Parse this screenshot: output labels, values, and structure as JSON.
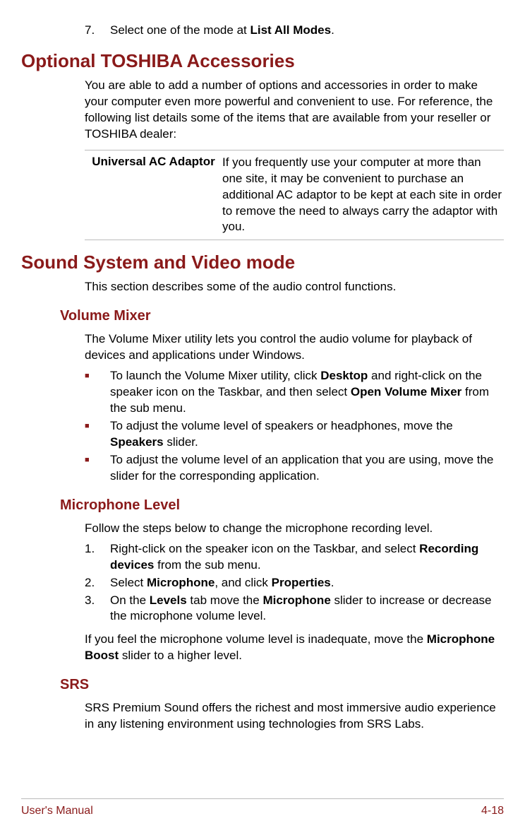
{
  "step7": {
    "num": "7.",
    "pre": "Select one of the mode at ",
    "bold": "List All Modes",
    "post": "."
  },
  "h1_accessories": "Optional TOSHIBA Accessories",
  "accessories_intro": "You are able to add a number of options and accessories in order to make your computer even more powerful and convenient to use. For reference, the following list details some of the items that are available from your reseller or TOSHIBA dealer:",
  "accessory": {
    "label": "Universal AC Adaptor",
    "desc": "If you frequently use your computer at more than one site, it may be convenient to purchase an additional AC adaptor to be kept at each site in order to remove the need to always carry the adaptor with you."
  },
  "h1_sound": "Sound System and Video mode",
  "sound_intro": "This section describes some of the audio control functions.",
  "h2_volume": "Volume Mixer",
  "volume_intro": "The Volume Mixer utility lets you control the audio volume for playback of devices and applications under Windows.",
  "volume_bullets": [
    {
      "p1": "To launch the Volume Mixer utility, click ",
      "b1": "Desktop",
      "p2": " and right-click on the speaker icon on the Taskbar, and then select ",
      "b2": "Open Volume Mixer",
      "p3": " from the sub menu."
    },
    {
      "p1": "To adjust the volume level of speakers or headphones, move the ",
      "b1": "Speakers",
      "p2": " slider.",
      "b2": "",
      "p3": ""
    },
    {
      "p1": "To adjust the volume level of an application that you are using, move the slider for the corresponding application.",
      "b1": "",
      "p2": "",
      "b2": "",
      "p3": ""
    }
  ],
  "h2_mic": "Microphone Level",
  "mic_intro": "Follow the steps below to change the microphone recording level.",
  "mic_steps": [
    {
      "num": "1.",
      "p1": "Right-click on the speaker icon on the Taskbar, and select ",
      "b1": "Recording devices",
      "p2": " from the sub menu.",
      "b2": "",
      "p3": "",
      "b3": "",
      "p4": ""
    },
    {
      "num": "2.",
      "p1": "Select ",
      "b1": "Microphone",
      "p2": ", and click ",
      "b2": "Properties",
      "p3": ".",
      "b3": "",
      "p4": ""
    },
    {
      "num": "3.",
      "p1": "On the ",
      "b1": "Levels",
      "p2": " tab move the ",
      "b2": "Microphone",
      "p3": " slider to increase or decrease the microphone volume level.",
      "b3": "",
      "p4": ""
    }
  ],
  "mic_note": {
    "p1": "If you feel the microphone volume level is inadequate, move the ",
    "b1": "Microphone Boost",
    "p2": " slider to a higher level."
  },
  "h2_srs": "SRS",
  "srs_text": "SRS Premium Sound offers the richest and most immersive audio experience in any listening environment using technologies from SRS Labs.",
  "footer": {
    "left": "User's Manual",
    "right": "4-18"
  }
}
